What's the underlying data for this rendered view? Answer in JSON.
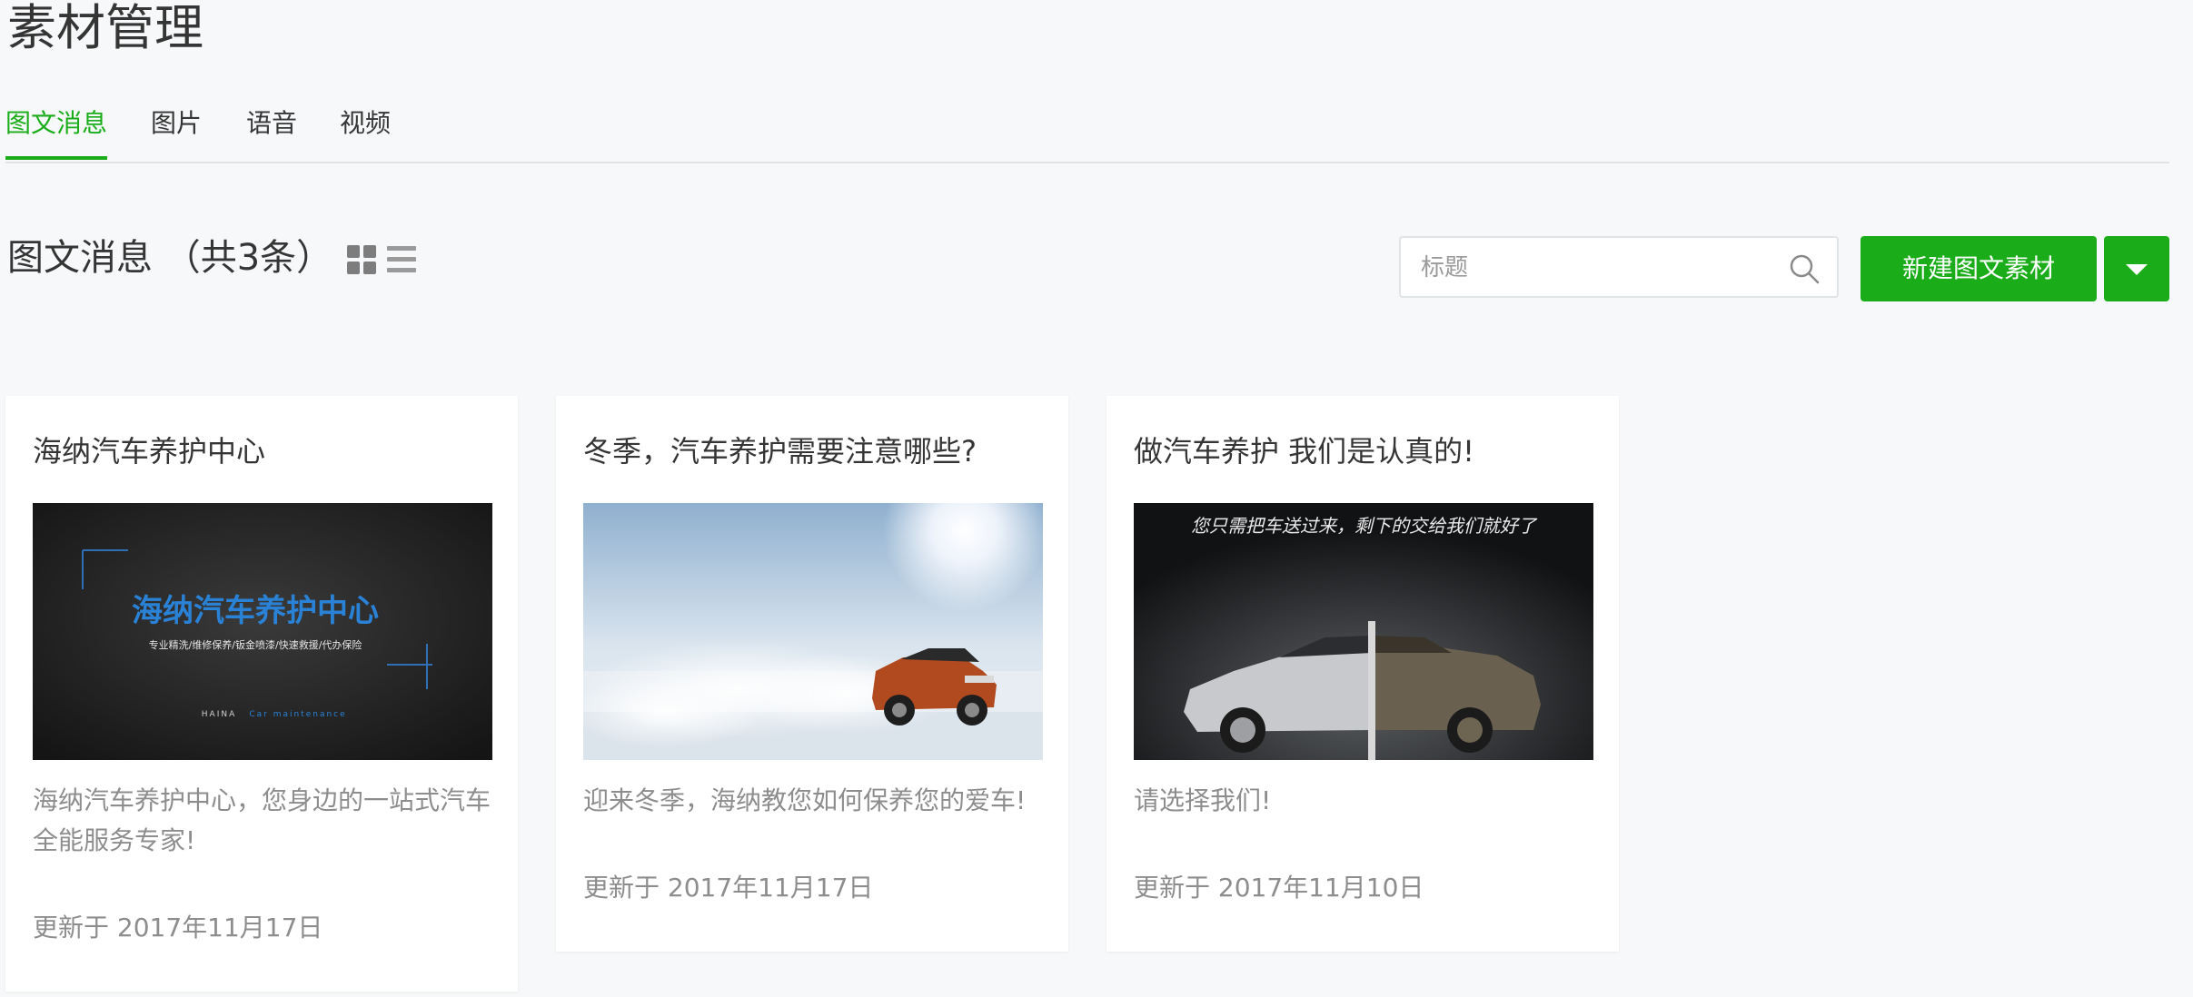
{
  "page": {
    "title": "素材管理"
  },
  "tabs": [
    {
      "label": "图文消息",
      "active": true
    },
    {
      "label": "图片",
      "active": false
    },
    {
      "label": "语音",
      "active": false
    },
    {
      "label": "视频",
      "active": false
    }
  ],
  "list_header": {
    "title": "图文消息 （共3条）",
    "view_icons": [
      "grid-view-icon",
      "list-view-icon"
    ]
  },
  "search": {
    "placeholder": "标题",
    "value": "",
    "icon": "search-icon"
  },
  "toolbar": {
    "new_button_label": "新建图文素材",
    "dropdown_icon": "caret-down-icon"
  },
  "colors": {
    "accent": "#1aad19",
    "background": "#f6f8f9",
    "muted_text": "#8d8d8d"
  },
  "cards": [
    {
      "title": "海纳汽车养护中心",
      "cover": {
        "headline": "海纳汽车养护中心",
        "tagline": "专业精洗/维修保养/钣金喷漆/快速救援/代办保险",
        "brand": "HAINA",
        "brand_sub": "Car maintenance"
      },
      "description": "海纳汽车养护中心，您身边的一站式汽车全能服务专家!",
      "date": "更新于 2017年11月17日"
    },
    {
      "title": "冬季，汽车养护需要注意哪些?",
      "description": "迎来冬季，海纳教您如何保养您的爱车!",
      "date": "更新于 2017年11月17日"
    },
    {
      "title": "做汽车养护 我们是认真的!",
      "cover": {
        "caption": "您只需把车送过来，剩下的交给我们就好了"
      },
      "description": "请选择我们!",
      "date": "更新于 2017年11月10日"
    }
  ]
}
